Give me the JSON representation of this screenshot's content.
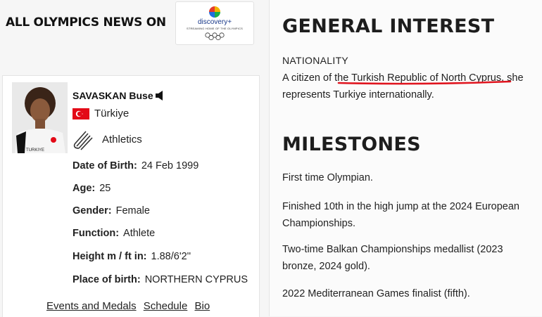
{
  "banner": {
    "title": "ALL OLYMPICS NEWS ON",
    "logo_name": "discovery+",
    "logo_tagline": "STREAMING HOME OF THE OLYMPICS"
  },
  "athlete": {
    "name": "SAVASKAN Buse",
    "country": "Türkiye",
    "sport": "Athletics",
    "details": [
      {
        "label": "Date of Birth:",
        "value": "24 Feb 1999"
      },
      {
        "label": "Age:",
        "value": "25"
      },
      {
        "label": "Gender:",
        "value": "Female"
      },
      {
        "label": "Function:",
        "value": "Athlete"
      },
      {
        "label": "Height m / ft in:",
        "value": "1.88/6'2''"
      },
      {
        "label": "Place of birth:",
        "value": "NORTHERN CYPRUS"
      }
    ],
    "links": [
      "Events and Medals",
      "Schedule",
      "Bio"
    ],
    "jersey_text": "TURKIYE"
  },
  "general_interest": {
    "heading": "GENERAL INTEREST",
    "nationality_label": "NATIONALITY",
    "nationality_text": "A citizen of the Turkish Republic of North Cyprus, she represents Turkiye internationally."
  },
  "milestones": {
    "heading": "MILESTONES",
    "items": [
      "First time Olympian.",
      "Finished 10th in the high jump at the 2024 European Championships.",
      "Two-time Balkan Championships medallist (2023 bronze, 2024 gold).",
      "2022 Mediterranean Games finalist (fifth)."
    ]
  },
  "colors": {
    "flag_red": "#e30a17",
    "underline_red": "#e0141e"
  }
}
